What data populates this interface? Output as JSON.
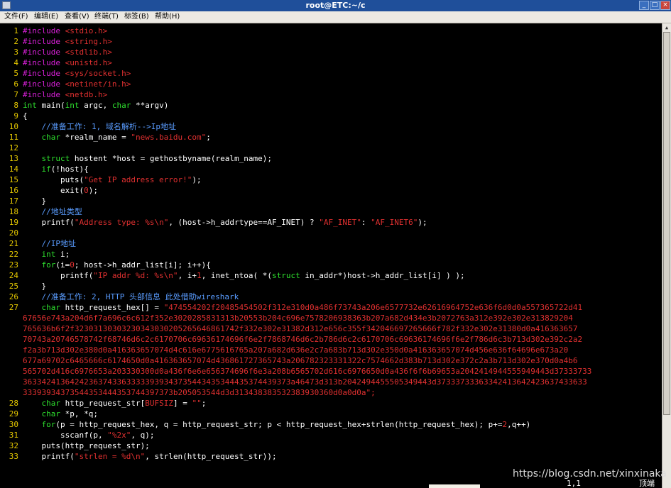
{
  "window": {
    "title": "root@ETC:~/c"
  },
  "menu": [
    "文件(F)",
    "编辑(E)",
    "查看(V)",
    "终端(T)",
    "标签(B)",
    "帮助(H)"
  ],
  "lines": [
    {
      "n": "1",
      "segs": [
        [
          "pp",
          "#include "
        ],
        [
          "st",
          "<stdio.h>"
        ]
      ]
    },
    {
      "n": "2",
      "segs": [
        [
          "pp",
          "#include "
        ],
        [
          "st",
          "<string.h>"
        ]
      ]
    },
    {
      "n": "3",
      "segs": [
        [
          "pp",
          "#include "
        ],
        [
          "st",
          "<stdlib.h>"
        ]
      ]
    },
    {
      "n": "4",
      "segs": [
        [
          "pp",
          "#include "
        ],
        [
          "st",
          "<unistd.h>"
        ]
      ]
    },
    {
      "n": "5",
      "segs": [
        [
          "pp",
          "#include "
        ],
        [
          "st",
          "<sys/socket.h>"
        ]
      ]
    },
    {
      "n": "6",
      "segs": [
        [
          "pp",
          "#include "
        ],
        [
          "st",
          "<netinet/in.h>"
        ]
      ]
    },
    {
      "n": "7",
      "segs": [
        [
          "pp",
          "#include "
        ],
        [
          "st",
          "<netdb.h>"
        ]
      ]
    },
    {
      "n": "8",
      "segs": [
        [
          "ty",
          "int"
        ],
        [
          "",
          " main("
        ],
        [
          "ty",
          "int"
        ],
        [
          "",
          " argc, "
        ],
        [
          "ty",
          "char"
        ],
        [
          "",
          " **argv)"
        ]
      ]
    },
    {
      "n": "9",
      "segs": [
        [
          "",
          "{"
        ]
      ]
    },
    {
      "n": "10",
      "segs": [
        [
          "cm",
          "    //准备工作: 1, 域名解析-->Ip地址"
        ]
      ]
    },
    {
      "n": "11",
      "segs": [
        [
          "ty",
          "    char"
        ],
        [
          "",
          " *realm_name = "
        ],
        [
          "st",
          "\"news.baidu.com\""
        ],
        [
          "",
          ";"
        ]
      ]
    },
    {
      "n": "12",
      "segs": []
    },
    {
      "n": "13",
      "segs": [
        [
          "ty",
          "    struct"
        ],
        [
          "",
          " hostent *host = gethostbyname(realm_name);"
        ]
      ]
    },
    {
      "n": "14",
      "segs": [
        [
          "ty",
          "    if"
        ],
        [
          "",
          "(!host){"
        ]
      ]
    },
    {
      "n": "15",
      "segs": [
        [
          "",
          "        puts("
        ],
        [
          "st",
          "\"Get IP address error!\""
        ],
        [
          "",
          ");"
        ]
      ]
    },
    {
      "n": "16",
      "segs": [
        [
          "",
          "        exit("
        ],
        [
          "nu",
          "0"
        ],
        [
          "",
          ");"
        ]
      ]
    },
    {
      "n": "17",
      "segs": [
        [
          "",
          "    }"
        ]
      ]
    },
    {
      "n": "18",
      "segs": [
        [
          "cm",
          "    //地址类型"
        ]
      ]
    },
    {
      "n": "19",
      "segs": [
        [
          "",
          "    printf("
        ],
        [
          "st",
          "\"Address type: %s\\n\""
        ],
        [
          "",
          ", (host->h_addrtype==AF_INET) ? "
        ],
        [
          "st",
          "\"AF_INET\""
        ],
        [
          "",
          ": "
        ],
        [
          "st",
          "\"AF_INET6\""
        ],
        [
          "",
          ");"
        ]
      ]
    },
    {
      "n": "20",
      "segs": []
    },
    {
      "n": "21",
      "segs": [
        [
          "cm",
          "    //IP地址"
        ]
      ]
    },
    {
      "n": "22",
      "segs": [
        [
          "ty",
          "    int"
        ],
        [
          "",
          " i;"
        ]
      ]
    },
    {
      "n": "23",
      "segs": [
        [
          "ty",
          "    for"
        ],
        [
          "",
          "(i="
        ],
        [
          "nu",
          "0"
        ],
        [
          "",
          "; host->h_addr_list[i]; i++){"
        ]
      ]
    },
    {
      "n": "24",
      "segs": [
        [
          "",
          "        printf("
        ],
        [
          "st",
          "\"IP addr %d: %s\\n\""
        ],
        [
          "",
          ", i+"
        ],
        [
          "nu",
          "1"
        ],
        [
          "",
          ", inet_ntoa( *("
        ],
        [
          "ty",
          "struct"
        ],
        [
          "",
          " in_addr*)host->h_addr_list[i] ) );"
        ]
      ]
    },
    {
      "n": "25",
      "segs": [
        [
          "",
          "    }"
        ]
      ]
    },
    {
      "n": "26",
      "segs": [
        [
          "cm",
          "    //准备工作: 2, HTTP 头部信息 此处借助wireshark"
        ]
      ]
    },
    {
      "n": "27",
      "segs": [
        [
          "ty",
          "    char"
        ],
        [
          "",
          " http_request_hex[] = "
        ],
        [
          "st",
          "\"474554202f20485454502f312e310d0a486f73743a206e6577732e62616964752e636f6d0d0a557365722d41"
        ]
      ]
    },
    {
      "n": "28",
      "segs": [
        [
          "ty",
          "    char"
        ],
        [
          "",
          " http_request_str["
        ],
        [
          "st",
          "BUFSIZ"
        ],
        [
          "",
          "] = "
        ],
        [
          "st",
          "\"\""
        ],
        [
          "",
          ";"
        ]
      ]
    },
    {
      "n": "29",
      "segs": [
        [
          "ty",
          "    char"
        ],
        [
          "",
          " *p, *q;"
        ]
      ]
    },
    {
      "n": "30",
      "segs": [
        [
          "ty",
          "    for"
        ],
        [
          "",
          "(p = http_request_hex, q = http_request_str; p < http_request_hex+strlen(http_request_hex); p+="
        ],
        [
          "nu",
          "2"
        ],
        [
          "",
          ",q++)"
        ]
      ]
    },
    {
      "n": "31",
      "segs": [
        [
          "",
          "        sscanf(p, "
        ],
        [
          "st",
          "\"%2x\""
        ],
        [
          "",
          ", q);"
        ]
      ]
    },
    {
      "n": "32",
      "segs": [
        [
          "",
          "    puts(http_request_str);"
        ]
      ]
    },
    {
      "n": "33",
      "segs": [
        [
          "",
          "    printf("
        ],
        [
          "st",
          "\"strlen = %d\\n\""
        ],
        [
          "",
          ", strlen(http_request_str));"
        ]
      ]
    }
  ],
  "wrapped_hex": [
    "67656e743a204d6f7a696c6c612f352e3020285831313b20553b204c696e7578206938363b207a682d434e3b2072763a312e392e302e313829204",
    "765636b6f2f32303130303230343030205265646861742f332e302e31382d312e656c355f342046697265666f782f332e302e31380d0a416363657",
    "70743a20746578742f68746d6c2c6170706c69636174696f6e2f7868746d6c2b786d6c2c6170706c69636174696f6e2f786d6c3b713d302e392c2a2",
    "f2a3b713d302e380d0a416363657074d4c616e6775616765a207a682d636e2c7a683b713d302e350d0a416363657074d456e636f64696e673a20",
    "677a69702c6465666c6174650d0a416363657074d436861727365743a206782323331322c7574662d383b713d302e372c2a3b713d302e370d0a4b6",
    "565702d416c6976653a203330300d0a436f6e6e656374696f6e3a208b6565702d616c6976650d0a436f6f6b69653a2042414944555949443d37333733",
    "363342413642423637433633333939343735443435344435374439373a46473d313b2042494455505349443d37333733363342413642423637433633",
    "33393934373544353444353744397373b205053544d3d313438383532383930360d0a0d0a\";"
  ],
  "status": {
    "position": "1,1",
    "scroll": "顶端"
  },
  "watermark": "https://blog.csdn.net/xinxinaka"
}
